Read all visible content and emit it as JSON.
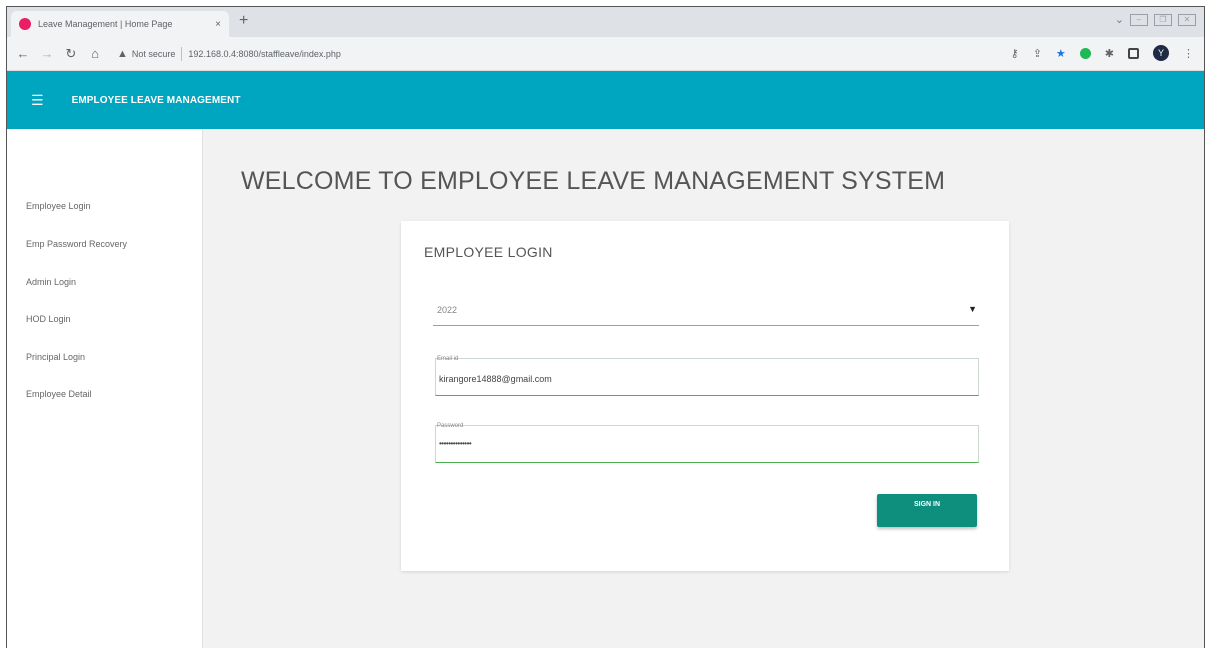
{
  "browser": {
    "tab_title": "Leave Management | Home Page",
    "tab_close": "×",
    "new_tab": "+",
    "not_secure": "Not secure",
    "url": "192.168.0.4:8080/staffleave/index.php",
    "avatar_letter": "Y"
  },
  "app": {
    "title": "EMPLOYEE LEAVE MANAGEMENT",
    "accent_color": "#00a5c0",
    "button_color": "#0e8f7e"
  },
  "sidebar": {
    "items": [
      {
        "label": "Employee Login"
      },
      {
        "label": "Emp Password Recovery"
      },
      {
        "label": "Admin Login"
      },
      {
        "label": "HOD Login"
      },
      {
        "label": "Principal Login"
      },
      {
        "label": "Employee Detail"
      }
    ]
  },
  "main": {
    "welcome": "WELCOME TO EMPLOYEE LEAVE MANAGEMENT SYSTEM",
    "form": {
      "title": "EMPLOYEE LOGIN",
      "year_value": "2022",
      "email_label": "Email id",
      "email_value": "kirangore14888@gmail.com",
      "password_label": "Password",
      "password_value": "••••••••••••••",
      "submit_label": "SIGN IN"
    }
  }
}
